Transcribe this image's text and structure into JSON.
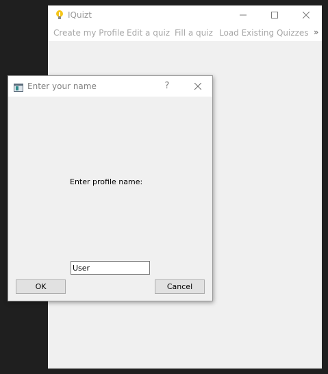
{
  "main_window": {
    "title": "IQuizt",
    "icon": "lightbulb-icon",
    "controls": [
      "minimize-icon",
      "maximize-icon",
      "close-icon"
    ],
    "menu": [
      "Create my Profile",
      "Edit a quiz",
      "Fill a quiz",
      "Load Existing Quizzes"
    ],
    "menu_overflow": "»"
  },
  "dialog": {
    "title": "Enter your name",
    "icon": "window-icon",
    "help": "?",
    "prompt": "Enter profile name:",
    "input_value": "User",
    "ok_label": "OK",
    "cancel_label": "Cancel"
  },
  "colors": {
    "desktop": "#1f1f1f",
    "window_bg": "#f0f0f0",
    "titlebar_bg": "#ffffff",
    "disabled_text": "#a8a8a8",
    "bulb": "#f5c518"
  }
}
